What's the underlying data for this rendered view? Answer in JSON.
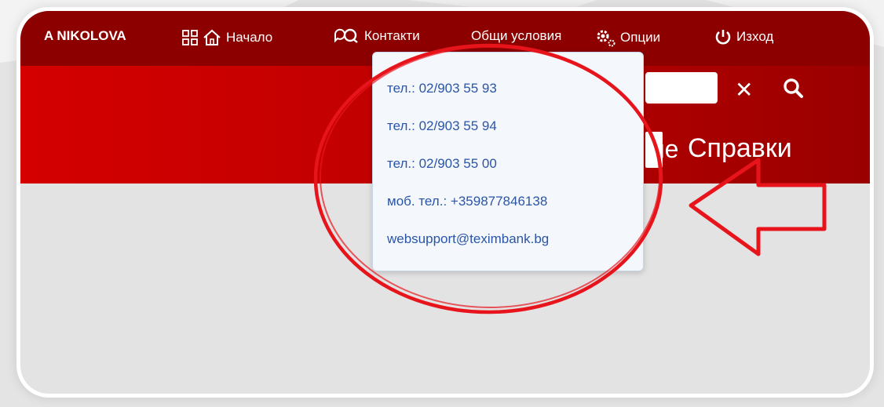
{
  "topbar": {
    "user_name": "A NIKOLOVA",
    "home_label": "Начало",
    "contacts_label": "Контакти",
    "terms_label": "Общи условия",
    "options_label": "Опции",
    "logout_label": "Изход"
  },
  "search": {
    "clear_symbol": "✕"
  },
  "nav": {
    "partial_label": "не",
    "reports_label": "Справки"
  },
  "contacts_dropdown": {
    "items": [
      "тел.: 02/903 55 93",
      "тел.: 02/903 55 94",
      "тел.: 02/903 55 00",
      "моб. тел.: +359877846138",
      "websupport@teximbank.bg"
    ]
  },
  "colors": {
    "topbar": "#8c0000",
    "banner": "#d40000",
    "link": "#2a55a6",
    "annotation": "#e8141c"
  },
  "icons": {
    "apps": "apps-grid-icon",
    "home": "home-icon",
    "contacts": "chat-bubbles-icon",
    "options": "gears-icon",
    "logout": "power-icon",
    "clear": "close-icon",
    "search": "search-icon"
  }
}
